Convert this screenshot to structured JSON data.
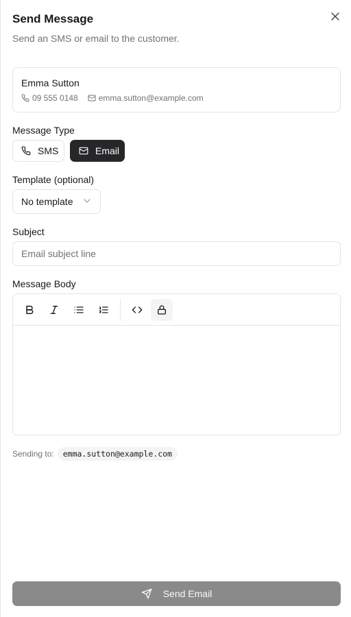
{
  "header": {
    "title": "Send Message",
    "subtitle": "Send an SMS or email to the customer."
  },
  "customer": {
    "name": "Emma Sutton",
    "phone": "09 555 0148",
    "email": "emma.sutton@example.com"
  },
  "message_type": {
    "label": "Message Type",
    "options": [
      "SMS",
      "Email"
    ],
    "selected": "Email"
  },
  "template": {
    "label": "Template (optional)",
    "selected": "No template"
  },
  "subject": {
    "label": "Subject",
    "value": "",
    "placeholder": "Email subject line"
  },
  "body": {
    "label": "Message Body",
    "value": "",
    "toolbar": [
      "bold",
      "italic",
      "bullet-list",
      "ordered-list",
      "code",
      "lock"
    ]
  },
  "sending": {
    "label": "Sending to:",
    "recipient": "emma.sutton@example.com"
  },
  "send_button": {
    "label": "Send Email"
  },
  "colors": {
    "primary_dark": "#27272a",
    "muted_text": "#71717a",
    "border": "#e4e4e7",
    "disabled_button": "#8a8a8a"
  }
}
